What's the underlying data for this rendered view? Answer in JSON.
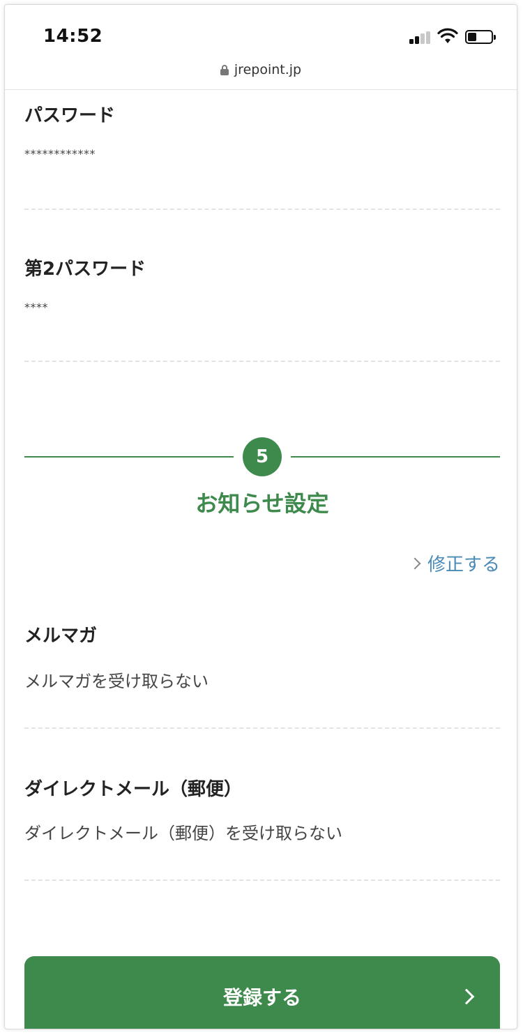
{
  "status_bar": {
    "time": "14:52"
  },
  "browser": {
    "url": "jrepoint.jp"
  },
  "account": {
    "password": {
      "label": "パスワード",
      "value": "************"
    },
    "second_password": {
      "label": "第2パスワード",
      "value": "****"
    }
  },
  "notification_section": {
    "step_number": "5",
    "title": "お知らせ設定",
    "edit_label": "修正する",
    "fields": [
      {
        "label": "メルマガ",
        "value": "メルマガを受け取らない"
      },
      {
        "label": "ダイレクトメール（郵便）",
        "value": "ダイレクトメール（郵便）を受け取らない"
      }
    ]
  },
  "submit": {
    "label": "登録する"
  },
  "colors": {
    "accent": "#3e8a4c",
    "link": "#4a8bb5"
  },
  "icons": [
    "lock-icon",
    "signal-icon",
    "wifi-icon",
    "battery-icon",
    "chevron-right-icon"
  ]
}
